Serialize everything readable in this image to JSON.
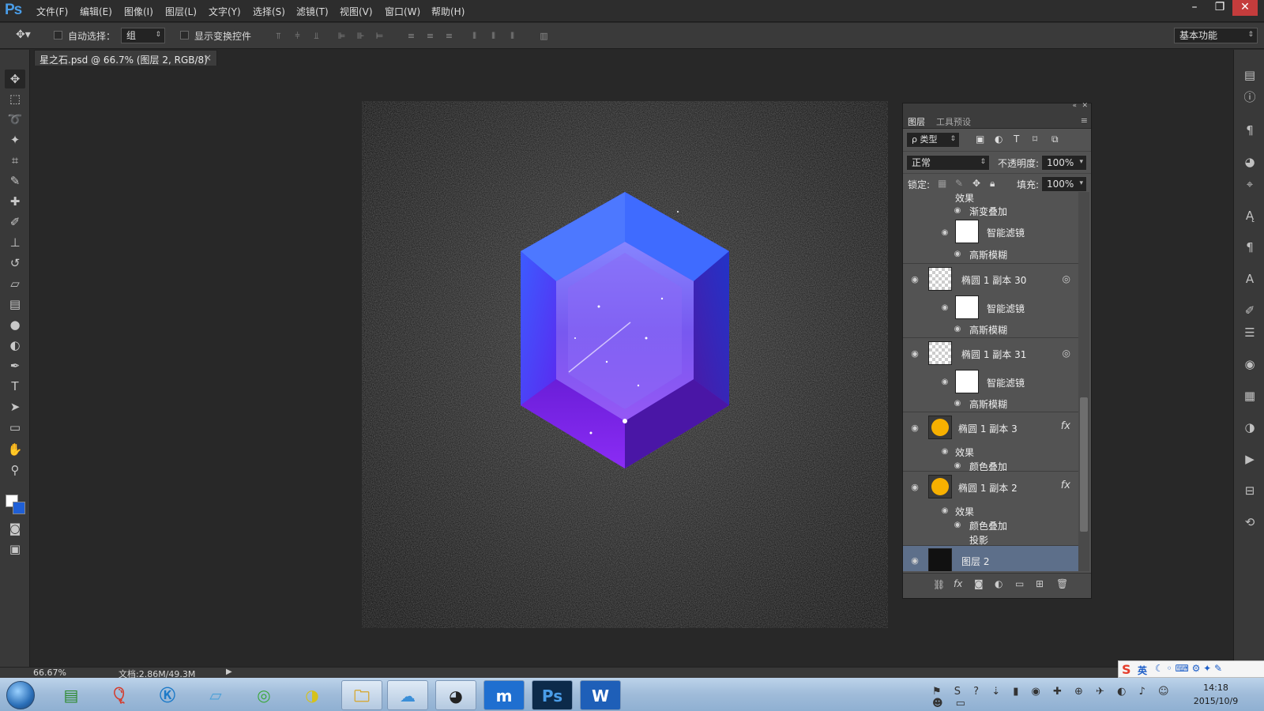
{
  "app": {
    "logo": "Ps",
    "menu": [
      "文件(F)",
      "编辑(E)",
      "图像(I)",
      "图层(L)",
      "文字(Y)",
      "选择(S)",
      "滤镜(T)",
      "视图(V)",
      "窗口(W)",
      "帮助(H)"
    ],
    "window_controls": [
      "–",
      "❐",
      "✕"
    ]
  },
  "options": {
    "auto_select_label": "自动选择：",
    "auto_select_value": "组",
    "show_transform_label": "显示变换控件",
    "workspace": "基本功能"
  },
  "document": {
    "tab_title": "星之石.psd @ 66.7% (图层 2, RGB/8) *",
    "close": "×"
  },
  "layers_panel": {
    "tabs": [
      "图层",
      "工具预设"
    ],
    "filter_label": "ρ 类型",
    "blend_mode": "正常",
    "opacity_label": "不透明度:",
    "opacity_value": "100%",
    "lock_label": "锁定:",
    "fill_label": "填充:",
    "fill_value": "100%",
    "rows": {
      "r0_sub": "效果",
      "r0_a": "渐变叠加",
      "r0_b": "智能滤镜",
      "r0_c": "高斯模糊",
      "l30_name": "椭圆 1 副本 30",
      "l30_sf": "智能滤镜",
      "l30_gb": "高斯模糊",
      "l31_name": "椭圆 1 副本 31",
      "l31_sf": "智能滤镜",
      "l31_gb": "高斯模糊",
      "l3_name": "椭圆 1 副本 3",
      "l3_fx": "fx",
      "l3_eff": "效果",
      "l3_co": "颜色叠加",
      "l2_name": "椭圆 1 副本 2",
      "l2_fx": "fx",
      "l2_eff": "效果",
      "l2_co": "颜色叠加",
      "l2_ds": "投影",
      "bg_name": "图层 2"
    }
  },
  "status": {
    "zoom": "66.67%",
    "doc_size": "文档:2.86M/49.3M"
  },
  "taskbar": {
    "clock_time": "14:18",
    "clock_date": "2015/10/9",
    "ime_label": "英"
  },
  "colors": {
    "accent_blue": "#4a9de8",
    "gem_top": "#2a3cff",
    "gem_bottom": "#7a2cff",
    "selected_layer": "#5d6f8a"
  }
}
